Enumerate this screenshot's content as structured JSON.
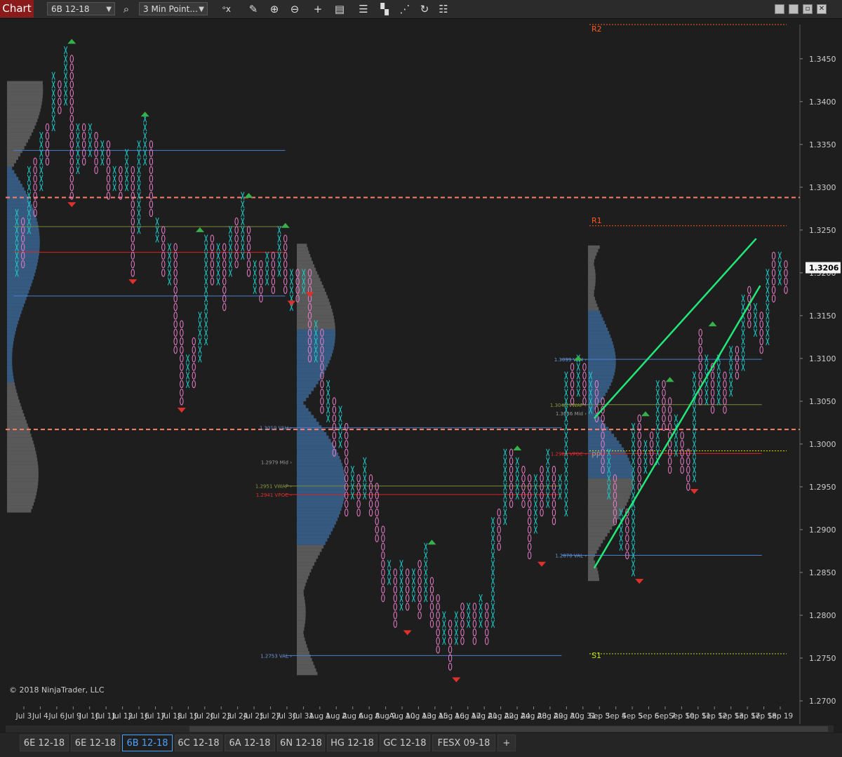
{
  "toolbar": {
    "chart_label": "Chart",
    "instrument": "6B 12-18",
    "period": "3 Min Point...",
    "icons": [
      "search-icon",
      "bar-type-icon",
      "pencil-icon",
      "zoom-in-icon",
      "zoom-out-icon",
      "crosshair-icon",
      "data-box-icon",
      "strategies-icon",
      "drawing-tools-icon",
      "indicators-icon",
      "reload-icon",
      "properties-icon"
    ]
  },
  "window_buttons": [
    "minimize",
    "restore",
    "maximize",
    "close"
  ],
  "copyright": "© 2018 NinjaTrader, LLC",
  "chart_data": {
    "type": "point-and-figure",
    "instrument": "6B 12-18",
    "ylim": [
      1.27,
      1.349
    ],
    "y_ticks": [
      "1.3450",
      "1.3400",
      "1.3350",
      "1.3300",
      "1.3250",
      "1.3200",
      "1.3150",
      "1.3100",
      "1.3050",
      "1.3000",
      "1.2950",
      "1.2900",
      "1.2850",
      "1.2800",
      "1.2750",
      "1.2700"
    ],
    "last_price": "1.3206",
    "x_labels": [
      "Jul 3",
      "Jul 4",
      "Jul 6",
      "Jul 9",
      "Jul 10",
      "Jul 11",
      "Jul 12",
      "Jul 16",
      "Jul 17",
      "Jul 18",
      "Jul 19",
      "Jul 20",
      "Jul 23",
      "Jul 24",
      "Jul 25",
      "Jul 27",
      "Jul 30",
      "Jul 31",
      "Aug 1",
      "Aug 2",
      "Aug 6",
      "Aug 8",
      "Aug 9",
      "Aug 10",
      "Aug 13",
      "Aug 15",
      "Aug 16",
      "Aug 17",
      "Aug 21",
      "Aug 22",
      "Aug 24",
      "Aug 28",
      "Aug 29",
      "Aug 30",
      "Aug 31",
      "Sep 3",
      "Sep 4",
      "Sep 5",
      "Sep 6",
      "Sep 7",
      "Sep 10",
      "Sep 11",
      "Sep 12",
      "Sep 13",
      "Sep 17",
      "Sep 18",
      "Sep 19"
    ],
    "pivots": {
      "R2": 1.349,
      "R1": 1.3255,
      "PP": 1.2992,
      "S1": 1.2755
    },
    "pivot_labels": [
      "R2",
      "R1",
      "PP",
      "S1"
    ],
    "dashed_levels": [
      1.3288,
      1.3017
    ],
    "profile_labels": [
      {
        "text": "1.3019 VAH",
        "value": 1.3019
      },
      {
        "text": "1.2979 Mid",
        "value": 1.2979
      },
      {
        "text": "1.2951 VWAP",
        "value": 1.2951
      },
      {
        "text": "1.2941 VPOC",
        "value": 1.2941
      },
      {
        "text": "1.2753 VAL",
        "value": 1.2753
      },
      {
        "text": "1.3099 VAH",
        "value": 1.3099
      },
      {
        "text": "1.3046 VWAP",
        "value": 1.3046
      },
      {
        "text": "1.3036 Mid",
        "value": 1.3036
      },
      {
        "text": "1.2989 VPOC",
        "value": 1.2989
      },
      {
        "text": "1.2870 VAL",
        "value": 1.287
      }
    ],
    "profile_lines": [
      {
        "value": 1.3343,
        "color": "#4a7fd0",
        "from": 0.01,
        "to": 0.352
      },
      {
        "value": 1.3254,
        "color": "#7a8a3a",
        "from": 0.01,
        "to": 0.352
      },
      {
        "value": 1.3224,
        "color": "#d22",
        "from": 0.01,
        "to": 0.352
      },
      {
        "value": 1.3173,
        "color": "#4a7fd0",
        "from": 0.01,
        "to": 0.352
      },
      {
        "value": 1.3019,
        "color": "#4a7fd0",
        "from": 0.352,
        "to": 0.7
      },
      {
        "value": 1.2951,
        "color": "#7a8a3a",
        "from": 0.352,
        "to": 0.7
      },
      {
        "value": 1.2941,
        "color": "#d22",
        "from": 0.352,
        "to": 0.7
      },
      {
        "value": 1.2753,
        "color": "#4a7fd0",
        "from": 0.352,
        "to": 0.7
      },
      {
        "value": 1.3099,
        "color": "#4a7fd0",
        "from": 0.7,
        "to": 0.952
      },
      {
        "value": 1.3046,
        "color": "#7a8a3a",
        "from": 0.7,
        "to": 0.952
      },
      {
        "value": 1.2989,
        "color": "#d22",
        "from": 0.7,
        "to": 0.952
      },
      {
        "value": 1.287,
        "color": "#4a7fd0",
        "from": 0.7,
        "to": 0.952
      }
    ],
    "columns": [
      [
        1.32,
        1.327,
        0
      ],
      [
        1.321,
        1.3265,
        1
      ],
      [
        1.325,
        1.332,
        0
      ],
      [
        1.327,
        1.333,
        1
      ],
      [
        1.33,
        1.336,
        0
      ],
      [
        1.333,
        1.337,
        1
      ],
      [
        1.337,
        1.343,
        0
      ],
      [
        1.339,
        1.342,
        1
      ],
      [
        1.34,
        1.346,
        0
      ],
      [
        1.329,
        1.345,
        1
      ],
      [
        1.332,
        1.337,
        0
      ],
      [
        1.333,
        1.337,
        1
      ],
      [
        1.334,
        1.337,
        0
      ],
      [
        1.332,
        1.3365,
        1
      ],
      [
        1.333,
        1.335,
        0
      ],
      [
        1.329,
        1.335,
        1
      ],
      [
        1.33,
        1.332,
        0
      ],
      [
        1.329,
        1.332,
        1
      ],
      [
        1.33,
        1.334,
        0
      ],
      [
        1.32,
        1.332,
        1
      ],
      [
        1.325,
        1.335,
        0
      ],
      [
        1.333,
        1.338,
        0
      ],
      [
        1.327,
        1.335,
        1
      ],
      [
        1.324,
        1.326,
        0
      ],
      [
        1.32,
        1.325,
        1
      ],
      [
        1.319,
        1.323,
        0
      ],
      [
        1.311,
        1.323,
        1
      ],
      [
        1.305,
        1.314,
        1
      ],
      [
        1.307,
        1.31,
        0
      ],
      [
        1.307,
        1.312,
        1
      ],
      [
        1.31,
        1.315,
        0
      ],
      [
        1.312,
        1.324,
        0
      ],
      [
        1.319,
        1.324,
        1
      ],
      [
        1.319,
        1.323,
        0
      ],
      [
        1.316,
        1.323,
        1
      ],
      [
        1.32,
        1.325,
        0
      ],
      [
        1.321,
        1.326,
        1
      ],
      [
        1.322,
        1.329,
        0
      ],
      [
        1.32,
        1.325,
        1
      ],
      [
        1.318,
        1.321,
        0
      ],
      [
        1.317,
        1.321,
        1
      ],
      [
        1.319,
        1.322,
        0
      ],
      [
        1.318,
        1.322,
        1
      ],
      [
        1.32,
        1.325,
        0
      ],
      [
        1.318,
        1.324,
        1
      ],
      [
        1.316,
        1.32,
        0
      ],
      [
        1.317,
        1.32,
        1
      ],
      [
        1.318,
        1.32,
        0
      ],
      [
        1.31,
        1.32,
        1
      ],
      [
        1.31,
        1.314,
        0
      ],
      [
        1.304,
        1.313,
        1
      ],
      [
        1.303,
        1.307,
        0
      ],
      [
        1.299,
        1.305,
        1
      ],
      [
        1.3,
        1.304,
        0
      ],
      [
        1.292,
        1.302,
        1
      ],
      [
        1.294,
        1.297,
        0
      ],
      [
        1.292,
        1.296,
        1
      ],
      [
        1.294,
        1.298,
        0
      ],
      [
        1.292,
        1.296,
        1
      ],
      [
        1.289,
        1.295,
        1
      ],
      [
        1.282,
        1.29,
        1
      ],
      [
        1.284,
        1.286,
        0
      ],
      [
        1.279,
        1.285,
        1
      ],
      [
        1.281,
        1.286,
        0
      ],
      [
        1.281,
        1.285,
        1
      ],
      [
        1.282,
        1.285,
        0
      ],
      [
        1.28,
        1.286,
        1
      ],
      [
        1.282,
        1.288,
        0
      ],
      [
        1.279,
        1.284,
        1
      ],
      [
        1.276,
        1.282,
        1
      ],
      [
        1.277,
        1.28,
        0
      ],
      [
        1.274,
        1.279,
        1
      ],
      [
        1.277,
        1.28,
        0
      ],
      [
        1.277,
        1.281,
        1
      ],
      [
        1.279,
        1.281,
        0
      ],
      [
        1.277,
        1.281,
        1
      ],
      [
        1.279,
        1.282,
        0
      ],
      [
        1.277,
        1.281,
        1
      ],
      [
        1.279,
        1.291,
        0
      ],
      [
        1.288,
        1.292,
        1
      ],
      [
        1.291,
        1.299,
        0
      ],
      [
        1.293,
        1.299,
        1
      ],
      [
        1.294,
        1.298,
        0
      ],
      [
        1.293,
        1.297,
        1
      ],
      [
        1.287,
        1.296,
        1
      ],
      [
        1.29,
        1.296,
        0
      ],
      [
        1.292,
        1.297,
        1
      ],
      [
        1.293,
        1.299,
        0
      ],
      [
        1.291,
        1.297,
        1
      ],
      [
        1.294,
        1.296,
        0
      ],
      [
        1.292,
        1.308,
        0
      ],
      [
        1.305,
        1.309,
        1
      ],
      [
        1.306,
        1.31,
        0
      ],
      [
        1.305,
        1.309,
        1
      ],
      [
        1.304,
        1.308,
        0
      ],
      [
        1.303,
        1.307,
        1
      ],
      [
        1.297,
        1.305,
        1
      ],
      [
        1.294,
        1.299,
        0
      ],
      [
        1.291,
        1.296,
        1
      ],
      [
        1.288,
        1.292,
        0
      ],
      [
        1.287,
        1.292,
        1
      ],
      [
        1.285,
        1.302,
        0
      ],
      [
        1.295,
        1.303,
        1
      ],
      [
        1.297,
        1.3,
        0
      ],
      [
        1.298,
        1.301,
        1
      ],
      [
        1.298,
        1.307,
        0
      ],
      [
        1.302,
        1.307,
        1
      ],
      [
        1.297,
        1.305,
        1
      ],
      [
        1.299,
        1.303,
        0
      ],
      [
        1.297,
        1.301,
        1
      ],
      [
        1.295,
        1.299,
        1
      ],
      [
        1.296,
        1.308,
        0
      ],
      [
        1.305,
        1.313,
        1
      ],
      [
        1.305,
        1.31,
        0
      ],
      [
        1.304,
        1.309,
        1
      ],
      [
        1.305,
        1.31,
        0
      ],
      [
        1.304,
        1.308,
        1
      ],
      [
        1.306,
        1.311,
        0
      ],
      [
        1.308,
        1.311,
        1
      ],
      [
        1.309,
        1.317,
        0
      ],
      [
        1.314,
        1.318,
        1
      ],
      [
        1.313,
        1.316,
        0
      ],
      [
        1.311,
        1.315,
        1
      ],
      [
        1.312,
        1.32,
        0
      ],
      [
        1.317,
        1.322,
        1
      ],
      [
        1.319,
        1.322,
        0
      ],
      [
        1.318,
        1.3215,
        1
      ]
    ],
    "swing_markers": [
      [
        9,
        1.347,
        "up"
      ],
      [
        9,
        1.328,
        "down"
      ],
      [
        21,
        1.3385,
        "up"
      ],
      [
        19,
        1.319,
        "down"
      ],
      [
        38,
        1.329,
        "up"
      ],
      [
        30,
        1.325,
        "up"
      ],
      [
        27,
        1.304,
        "down"
      ],
      [
        44,
        1.3255,
        "up"
      ],
      [
        45,
        1.3165,
        "down"
      ],
      [
        48,
        1.3175,
        "down"
      ],
      [
        64,
        1.278,
        "down"
      ],
      [
        72,
        1.2725,
        "down"
      ],
      [
        68,
        1.2885,
        "up"
      ],
      [
        82,
        1.2995,
        "up"
      ],
      [
        86,
        1.286,
        "down"
      ],
      [
        92,
        1.31,
        "up"
      ],
      [
        102,
        1.284,
        "down"
      ],
      [
        103,
        1.3035,
        "up"
      ],
      [
        107,
        1.3075,
        "up"
      ],
      [
        111,
        1.2945,
        "down"
      ],
      [
        114,
        1.314,
        "up"
      ]
    ],
    "channel_lines": [
      {
        "x1": 0.741,
        "y1": 1.303,
        "x2": 0.945,
        "y2": 1.324
      },
      {
        "x1": 0.741,
        "y1": 1.2855,
        "x2": 0.95,
        "y2": 1.3185
      }
    ],
    "colors": {
      "background": "#1e1e1e",
      "up_x": "#1fc7c7",
      "down_o": "#e87cc8",
      "channel": "#22e87a",
      "dashed": "#ff7f6a",
      "pivot_r": "#ff5a1f",
      "pivot_s": "#b8e01e",
      "pp": "#e8e400",
      "profile": "#8a8a8a",
      "profile_va": "#4a8ad0"
    }
  },
  "tabs": [
    "6E 12-18",
    "6E 12-18",
    "6B 12-18",
    "6C 12-18",
    "6A 12-18",
    "6N 12-18",
    "HG 12-18",
    "GC 12-18",
    "FESX 09-18"
  ],
  "active_tab": 2,
  "add_tab": "+"
}
